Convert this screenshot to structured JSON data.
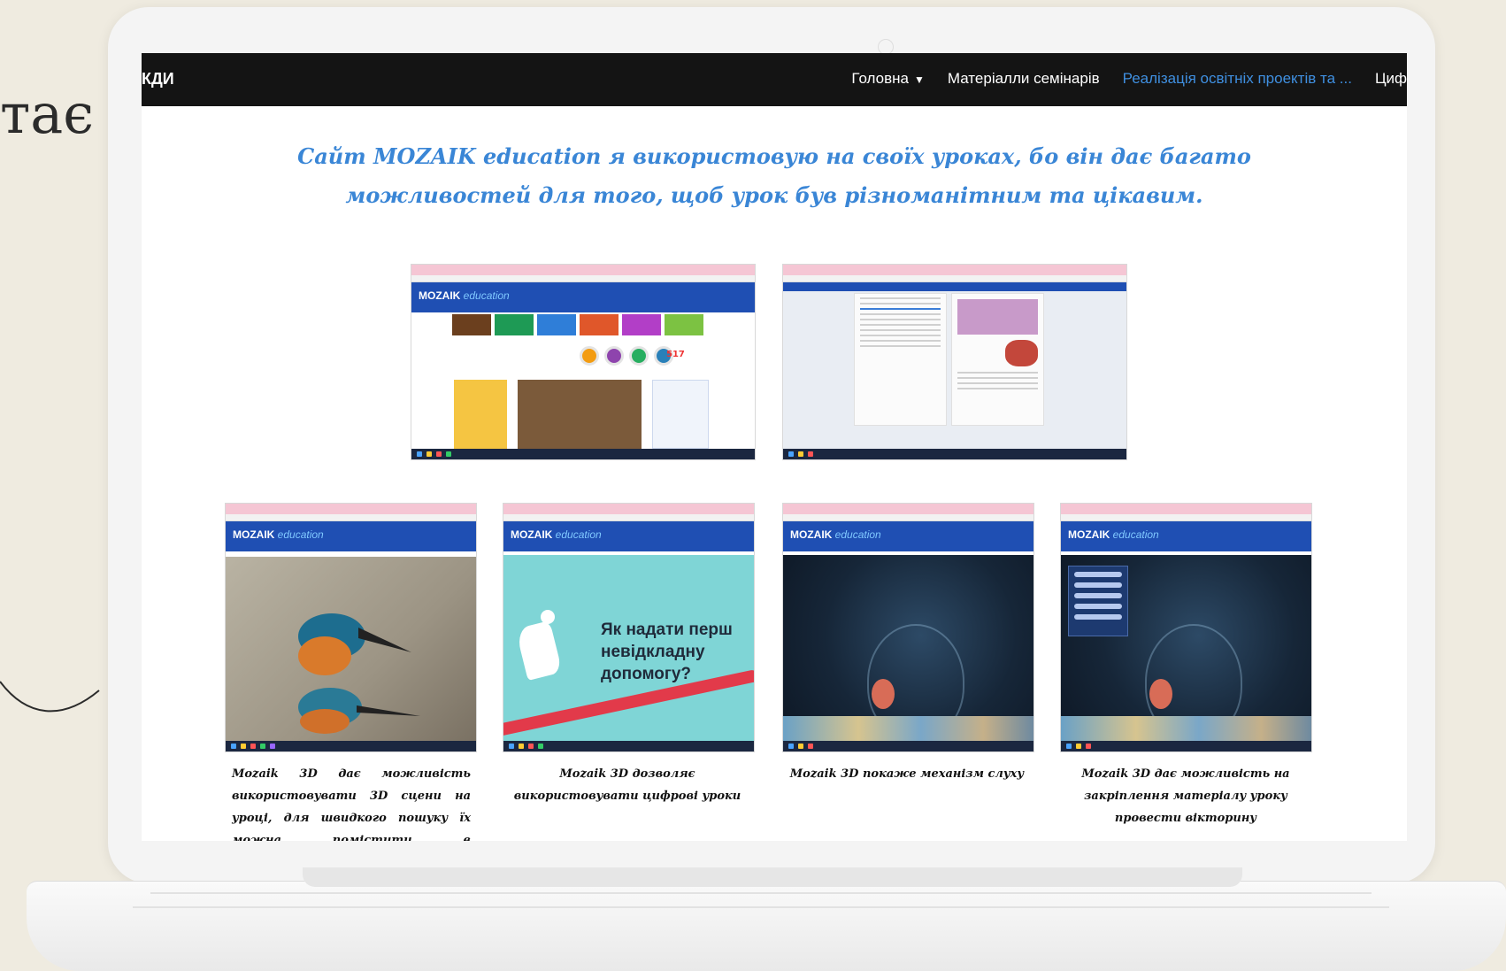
{
  "slide": {
    "partial_text": "тає"
  },
  "navbar": {
    "brand_fragment": "КДИ",
    "items": [
      {
        "label": "Головна",
        "active": false,
        "has_dropdown": true
      },
      {
        "label": "Матеріалли семінарів",
        "active": false,
        "has_dropdown": false
      },
      {
        "label": "Реалізація освітніх проектів та ...",
        "active": true,
        "has_dropdown": false
      },
      {
        "label": "Циф",
        "active": false,
        "has_dropdown": false
      }
    ],
    "dropdown_icon": "chevron-down-icon"
  },
  "heading": "Сайт MOZAIK education я використовую на своїх уроках, бо він дає багато можливостей для того, щоб урок був різноманітним та цікавим.",
  "screenshots": {
    "logo_main": "MOZAIK",
    "logo_sub": "education",
    "count": "517",
    "firstaid_text": "Як надати перш невідкладну допомогу?"
  },
  "captions": [
    "Mozaik 3D дає можливість використовувати 3D сцени на уроці, для швидкого пошуку їх можна помістити в",
    "Mozaik 3D дозволяє використовувати цифрові уроки",
    "Mozaik 3D покаже механізм слуху",
    "Mozaik 3D дає можливість на закріплення матеріалу уроку провести вікторину"
  ],
  "colors": {
    "nav_bg": "#141414",
    "nav_active": "#3f8fe0",
    "heading": "#3a86d6",
    "mozaik_blue": "#1f4fb3"
  }
}
